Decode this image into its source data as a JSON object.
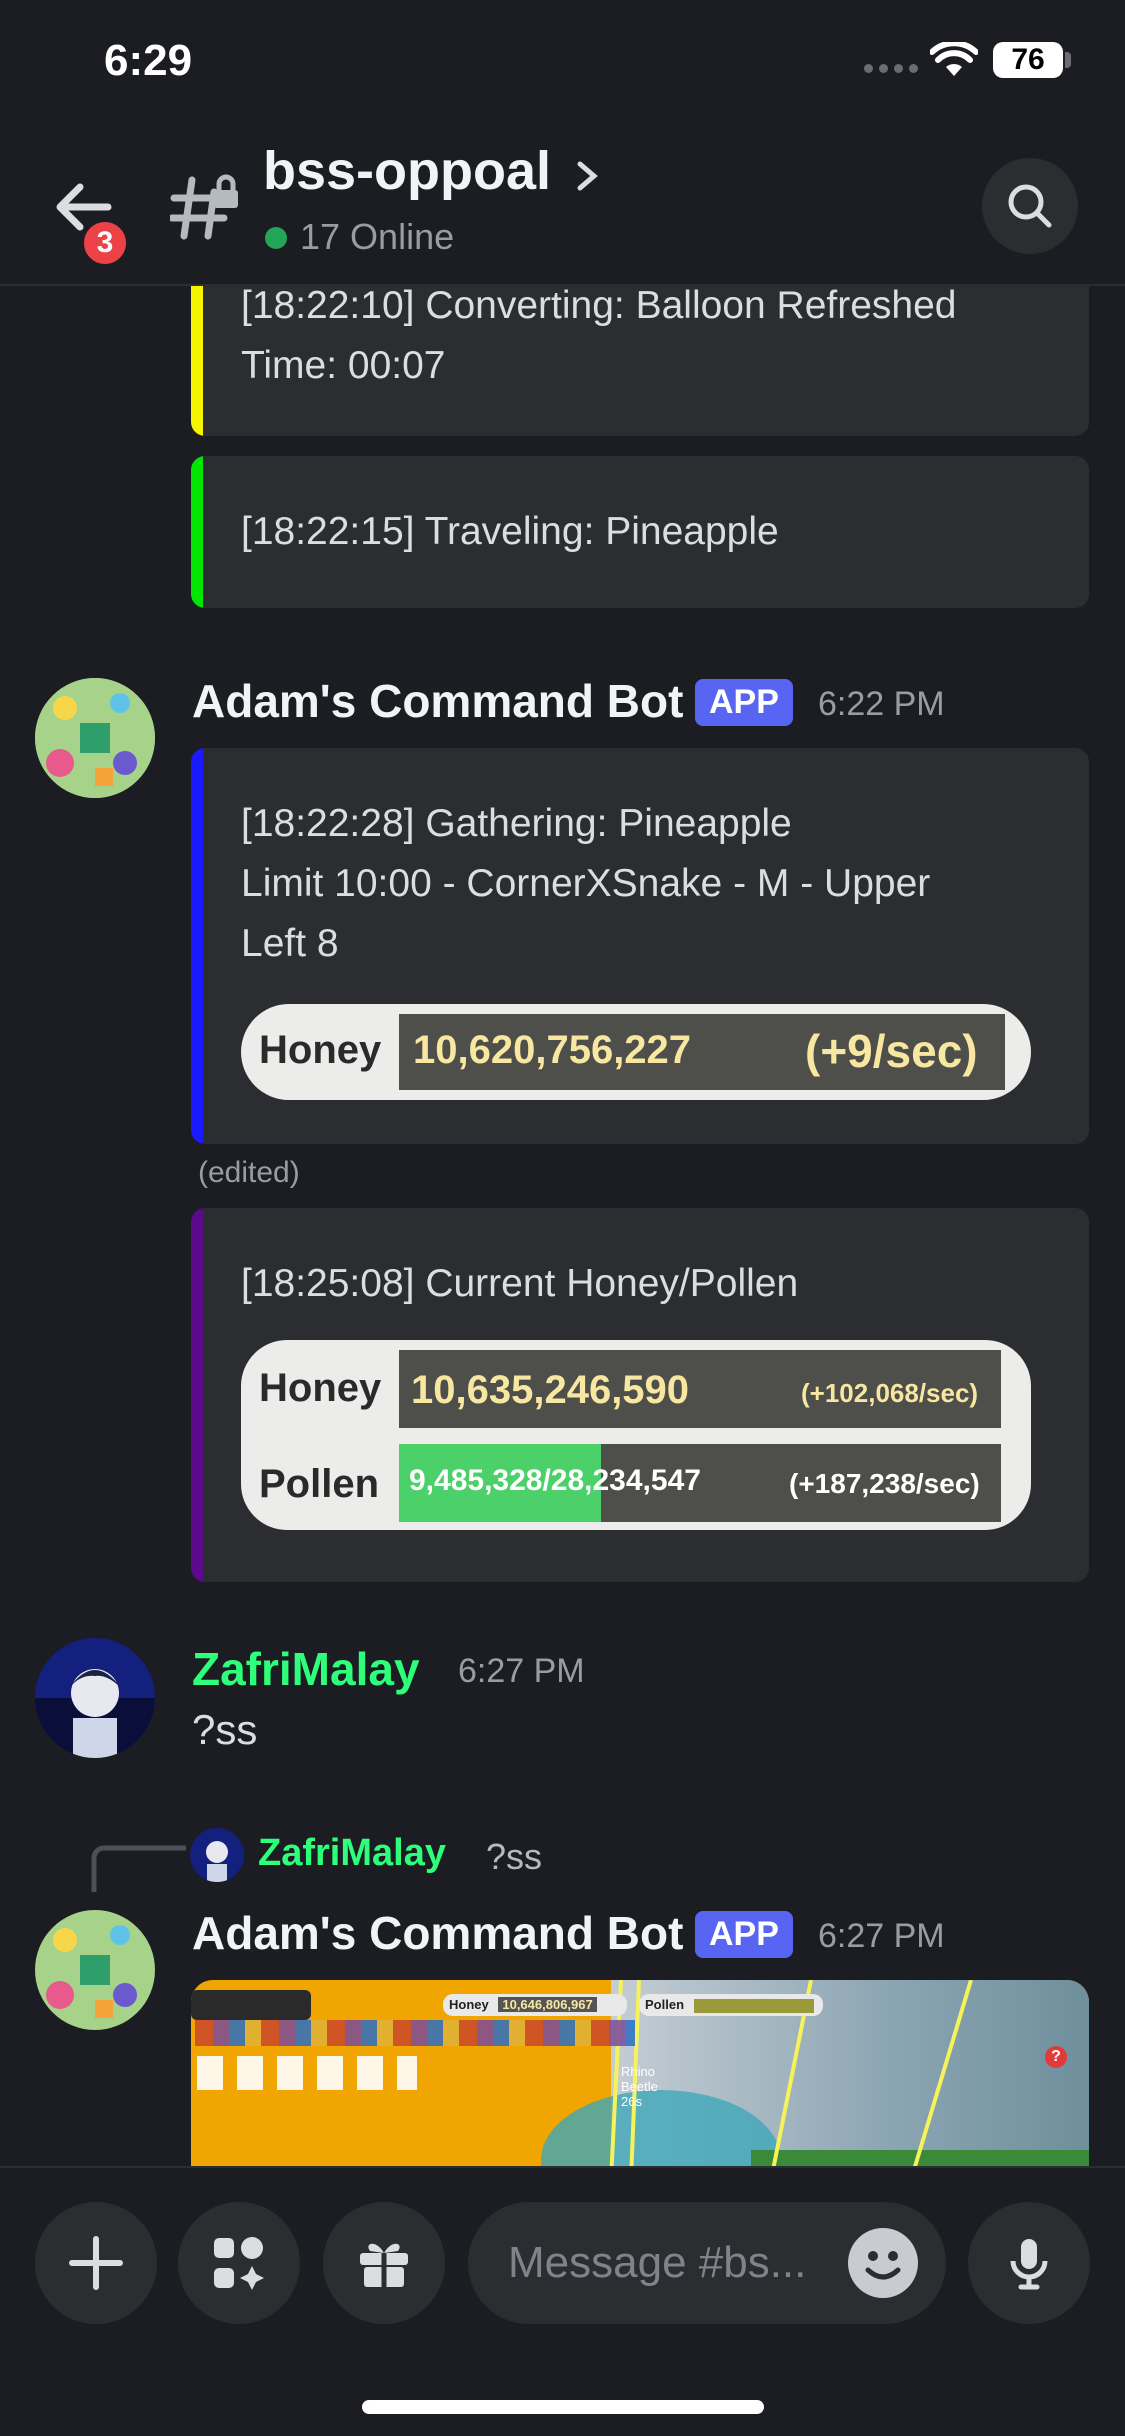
{
  "status_bar": {
    "time": "6:29",
    "battery": "76"
  },
  "header": {
    "back_badge": "3",
    "channel_name": "bss-oppoal",
    "online_text": "17 Online"
  },
  "messages": [
    {
      "type": "embed",
      "bar_color": "#f5f500",
      "text": "[18:22:10] Converting: Balloon Refreshed\nTime: 00:07"
    },
    {
      "type": "embed",
      "bar_color": "#00e600",
      "text": "[18:22:15] Traveling: Pineapple"
    },
    {
      "author": "Adam's Command Bot",
      "tag": "APP",
      "time": "6:22 PM",
      "embed": {
        "bar_color": "#1a1aff",
        "text": "[18:22:28] Gathering: Pineapple\nLimit 10:00 - CornerXSnake - M - Upper\nLeft 8",
        "honey_label": "Honey",
        "honey_value": "10,620,756,227",
        "honey_rate": "(+9/sec)"
      },
      "edited": "(edited)"
    },
    {
      "embed": {
        "bar_color": "#5a0a8a",
        "text": "[18:25:08] Current Honey/Pollen",
        "honey_label": "Honey",
        "honey_value": "10,635,246,590",
        "honey_rate": "(+102,068/sec)",
        "pollen_label": "Pollen",
        "pollen_value": "9,485,328/28,234,547",
        "pollen_rate": "(+187,238/sec)",
        "pollen_fill": 0.336
      }
    },
    {
      "author": "ZafriMalay",
      "author_color": "#2dff7a",
      "time": "6:27 PM",
      "text": "?ss"
    },
    {
      "reply": {
        "author": "ZafriMalay",
        "text": "?ss"
      },
      "author": "Adam's Command Bot",
      "tag": "APP",
      "time": "6:27 PM",
      "game_hud": {
        "honey_label": "Honey",
        "honey_value": "10,646,806,967",
        "pollen_label": "Pollen",
        "mob_label": "Rhino\nBeetle\n26s",
        "help_icon": "?"
      }
    }
  ],
  "composer": {
    "placeholder": "Message #bs..."
  },
  "colors": {
    "app_tag": "#5865f2",
    "online": "#23a55a",
    "badge": "#ed4245"
  },
  "icons": [
    "back-arrow-icon",
    "locked-channel-icon",
    "chevron-right-icon",
    "search-icon",
    "plus-icon",
    "apps-icon",
    "gift-icon",
    "emoji-icon",
    "microphone-icon"
  ]
}
